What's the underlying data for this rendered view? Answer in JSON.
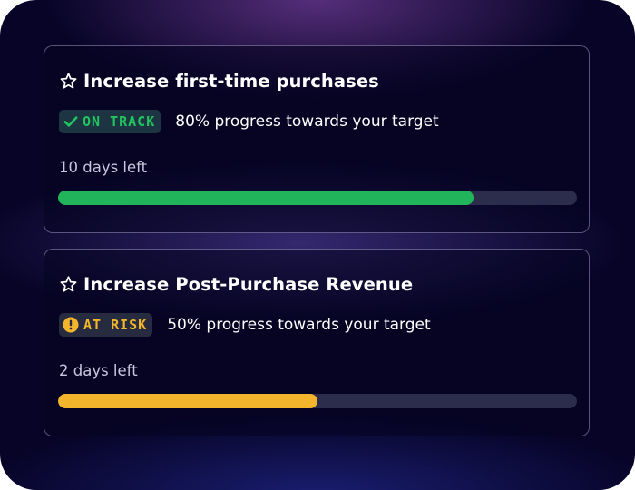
{
  "goals": [
    {
      "title": "Increase first-time purchases",
      "star_icon": "star-outline-icon",
      "status": {
        "label": "ON TRACK",
        "icon": "check-icon",
        "color": "#21c45f",
        "bg": "#1d3442"
      },
      "progress_text": "80% progress towards your target",
      "progress": 0.8,
      "days_left": "10 days left",
      "bar_color": "#22b45a"
    },
    {
      "title": "Increase Post-Purchase Revenue",
      "star_icon": "star-outline-icon",
      "status": {
        "label": "AT RISK",
        "icon": "exclamation-circle-icon",
        "color": "#f2b52c",
        "bg": "#262b40"
      },
      "progress_text": "50% progress towards your target",
      "progress": 0.5,
      "days_left": "2 days left",
      "bar_color": "#f2b52c"
    }
  ],
  "colors": {
    "background": "#070427",
    "track": "#2c2c4c",
    "text": "#ffffff",
    "muted_text": "#c9c6de"
  }
}
